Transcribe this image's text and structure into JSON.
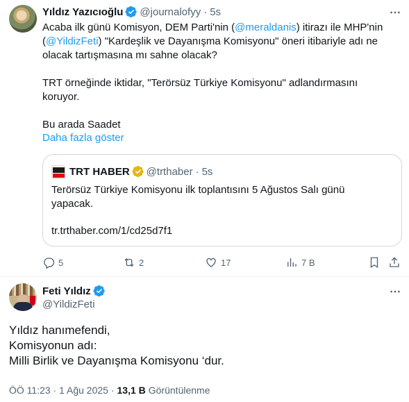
{
  "tweet1": {
    "author_name": "Yıldız Yazıcıoğlu",
    "handle": "@journalofyy",
    "separator": "·",
    "time": "5s",
    "line1_prefix": "Acaba ilk günü Komisyon, DEM Parti'nin (",
    "mention1": "@meraldanis",
    "line1_suffix": ") itirazı ile MHP'nin (",
    "mention2": "@YildizFeti",
    "line2_suffix": ") \"Kardeşlik ve Dayanışma Komisyonu\" öneri itibariyle adı ne olacak tartışmasına mı sahne olacak?",
    "para2": "TRT örneğinde iktidar, \"Terörsüz Türkiye Komisyonu\" adlandırmasını koruyor.",
    "para3": "Bu arada Saadet",
    "show_more": "Daha fazla göster",
    "quote": {
      "author_name": "TRT HABER",
      "handle": "@trthaber",
      "separator": "·",
      "time": "5s",
      "text": "Terörsüz Türkiye Komisyonu ilk toplantısını 5 Ağustos Salı günü yapacak.",
      "link": "tr.trthaber.com/1/cd25d7f1"
    },
    "actions": {
      "replies": "5",
      "reposts": "2",
      "likes": "17",
      "views": "7 B"
    }
  },
  "tweet2": {
    "author_name": "Feti Yıldız",
    "handle": "@YildizFeti",
    "line1": "Yıldız hanımefendi,",
    "line2": "Komisyonun adı:",
    "line3": "Milli Birlik ve Dayanışma Komisyonu ‘dur.",
    "timestamp": "ÖÖ 11:23 · 1 Ağu 2025 ·",
    "views_count": "13,1 B",
    "views_label": "Görüntülenme"
  },
  "colors": {
    "accent": "#1d9bf0",
    "secondary_text": "#536471",
    "border": "#cfd9de",
    "gold_badge": "#e2b719"
  },
  "icons": [
    "more-icon",
    "verified-badge-icon",
    "reply-icon",
    "repost-icon",
    "like-icon",
    "views-icon",
    "bookmark-icon",
    "share-icon"
  ]
}
